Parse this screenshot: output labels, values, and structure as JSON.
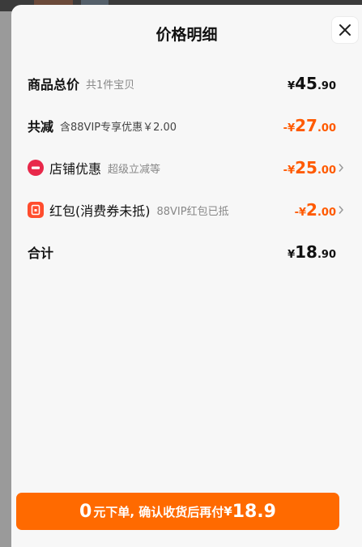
{
  "header": {
    "title": "价格明细"
  },
  "rows": [
    {
      "label": "商品总价",
      "sub": "共1件宝贝",
      "sign": "",
      "symbol": "¥",
      "int": "45",
      "dec": ".90"
    },
    {
      "label": "共减",
      "sub": "含88VIP专享优惠￥2.00",
      "sign": "-",
      "symbol": "¥",
      "int": "27",
      "dec": ".00"
    },
    {
      "label": "店铺优惠",
      "sub": "超级立减等",
      "sign": "-",
      "symbol": "¥",
      "int": "25",
      "dec": ".00"
    },
    {
      "label": "红包(消费券未抵)",
      "sub": "88VIP红包已抵",
      "sign": "-",
      "symbol": "¥",
      "int": "2",
      "dec": ".00"
    },
    {
      "label": "合计",
      "sub": "",
      "sign": "",
      "symbol": "¥",
      "int": "18",
      "dec": ".90"
    }
  ],
  "button": {
    "zero": "0",
    "text": "元下单, 确认收货后再付",
    "symbol": "¥",
    "amount": "18.9"
  },
  "colors": {
    "accent": "#ff6a00",
    "discount": "#ff5a00",
    "store_icon": "#e8284a"
  },
  "icons": {
    "close": "close-icon",
    "store": "store-icon",
    "red_packet": "red-packet-icon",
    "chevron": "chevron-right-icon"
  }
}
